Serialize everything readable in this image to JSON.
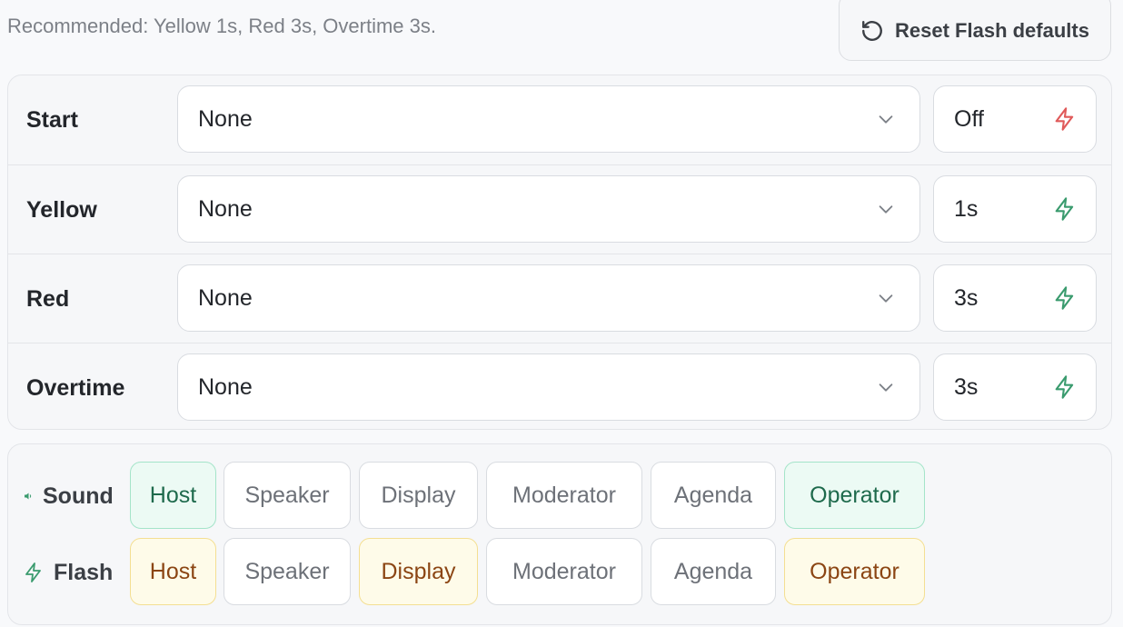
{
  "header": {
    "hint": "Recommended: Yellow 1s, Red 3s, Overtime 3s.",
    "reset_label": "Reset Flash defaults"
  },
  "colors": {
    "bolt_off": "#e05a5a",
    "bolt_on": "#3a9b6e",
    "chip_green_bg": "#ecfaf4",
    "chip_yellow_bg": "#fefbe9"
  },
  "phases": [
    {
      "label": "Start",
      "sound": "None",
      "flash": "Off",
      "flash_state": "off"
    },
    {
      "label": "Yellow",
      "sound": "None",
      "flash": "1s",
      "flash_state": "on"
    },
    {
      "label": "Red",
      "sound": "None",
      "flash": "3s",
      "flash_state": "on"
    },
    {
      "label": "Overtime",
      "sound": "None",
      "flash": "3s",
      "flash_state": "on"
    }
  ],
  "targets": {
    "sound": {
      "label": "Sound",
      "icon": "speaker-icon",
      "chips": [
        {
          "label": "Host",
          "selected": true
        },
        {
          "label": "Speaker",
          "selected": false
        },
        {
          "label": "Display",
          "selected": false
        },
        {
          "label": "Moderator",
          "selected": false
        },
        {
          "label": "Agenda",
          "selected": false
        },
        {
          "label": "Operator",
          "selected": true
        }
      ]
    },
    "flash": {
      "label": "Flash",
      "icon": "lightning-icon",
      "chips": [
        {
          "label": "Host",
          "selected": true
        },
        {
          "label": "Speaker",
          "selected": false
        },
        {
          "label": "Display",
          "selected": true
        },
        {
          "label": "Moderator",
          "selected": false
        },
        {
          "label": "Agenda",
          "selected": false
        },
        {
          "label": "Operator",
          "selected": true
        }
      ]
    }
  }
}
